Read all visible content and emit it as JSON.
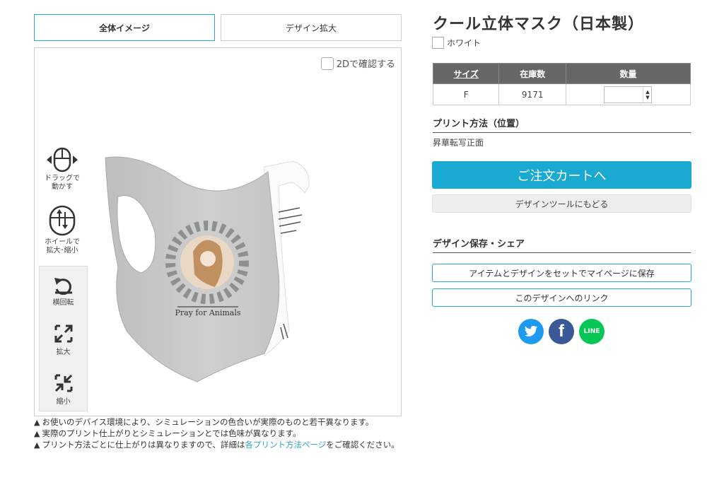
{
  "tabs": {
    "overall": "全体イメージ",
    "zoom": "デザイン拡大"
  },
  "preview": {
    "check_2d_label": "2Dで確認する",
    "controls": {
      "drag": "ドラッグで動かす",
      "wheel": "ホイールで拡大･縮小"
    },
    "rotate_panel": {
      "rotate": "横回転",
      "zoom_in": "拡大",
      "zoom_out": "縮小"
    },
    "mask_print_text": "Pray for Animals"
  },
  "notes": [
    "お使いのデバイス環境により、シミュレーションの色合いが実際のものと若干異なります。",
    "実際のプリント仕上がりとシミュレーションとでは色味が異なります。"
  ],
  "note3": {
    "before": "プリント方法ごとに仕上がりは異なりますので、詳細は",
    "link": "各プリント方法ページ",
    "after": "をご確認ください。"
  },
  "product": {
    "title": "クール立体マスク（日本製）",
    "color": "ホワイト"
  },
  "stock_table": {
    "headers": [
      "サイズ",
      "在庫数",
      "数量"
    ],
    "rows": [
      {
        "size": "F",
        "stock": "9171",
        "qty": ""
      }
    ]
  },
  "print_method": {
    "heading": "プリント方法（位置）",
    "value": "昇華転写正面"
  },
  "buttons": {
    "cart": "ご注文カートへ",
    "back": "デザインツールにもどる",
    "save": "アイテムとデザインをセットでマイページに保存",
    "link": "このデザインへのリンク"
  },
  "share": {
    "heading": "デザイン保存・シェア",
    "line_label": "LINE"
  },
  "colors": {
    "accent": "#1aa9d0",
    "header_bg": "#666666",
    "twitter": "#1d9bf0",
    "facebook": "#3b5998",
    "line": "#06c755"
  }
}
